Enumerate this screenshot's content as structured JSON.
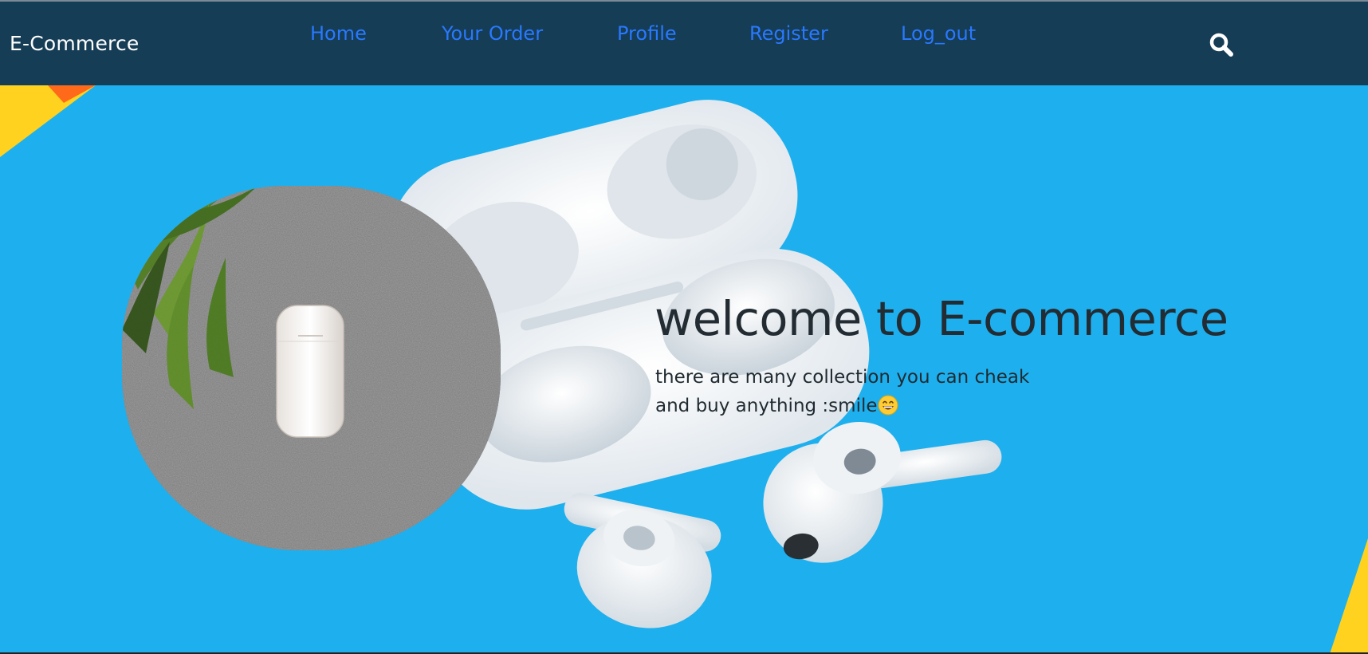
{
  "navbar": {
    "brand": "E-Commerce",
    "links": [
      {
        "label": "Home"
      },
      {
        "label": "Your Order"
      },
      {
        "label": "Profile"
      },
      {
        "label": "Register"
      },
      {
        "label": "Log_out"
      }
    ],
    "search_icon": "search-icon",
    "background": "#163d56",
    "link_color": "#2979ff"
  },
  "hero": {
    "title": "welcome to E-commerce",
    "subtitle_line1": "there are many collection you can cheak",
    "subtitle_line2": "and buy anything :smile",
    "emoji_icon": "grinning-face-icon",
    "background": "#1eb0ee"
  }
}
